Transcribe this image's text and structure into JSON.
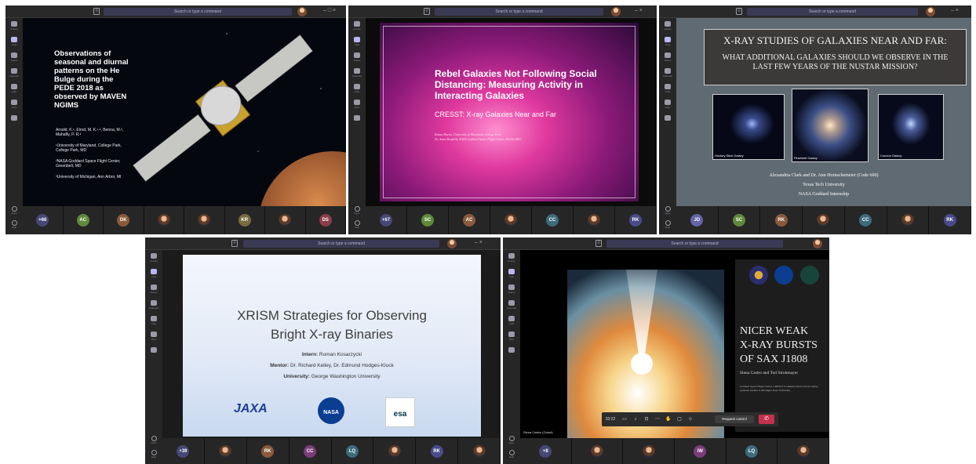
{
  "search": {
    "placeholder": "Search or type a command"
  },
  "rail_labels": [
    "Activity",
    "Chat",
    "Teams",
    "Calendar",
    "Calls",
    "Files",
    "..."
  ],
  "rail_bottom_labels": [
    "Apps",
    "Help"
  ],
  "window1": {
    "title_lines": [
      "Observations of",
      "seasonal and diurnal",
      "patterns on the He",
      "Bulge during the",
      "PEDE 2018 as",
      "observed by MAVEN",
      "NGIMS"
    ],
    "bullets": [
      "Arnold, K.¹, Elrod, M. K.¹·², Benna, M.², Mahaffy, P. R.²",
      "¹University of Maryland, College Park, College Park, MD",
      "²NASA Goddard Space Flight Center, Greenbelt, MD",
      "³University of Michigan, Ann Arbor, MI"
    ],
    "participants": [
      "+66",
      "AC",
      "DK",
      "",
      "",
      "KR",
      "",
      "DS"
    ],
    "colors": {
      "bg": "#0b0d18",
      "accent": "#5b5fc7"
    }
  },
  "window2": {
    "title": "Rebel Galaxies Not Following Social Distancing: Measuring Activity in Interacting Galaxies",
    "subtitle": "CRESST: X-ray Galaxies Near and Far",
    "authors": "Emma Harris, University of Maryland, College Park",
    "mentor": "Dr. Anna Bonfield, NASA Goddard Space Flight Center, NASA GSFC",
    "participants": [
      "+67",
      "SC",
      "AC",
      "",
      "CC",
      "",
      "RK"
    ],
    "colors": {
      "slide": "#c8338f"
    }
  },
  "window3": {
    "title": "X-RAY STUDIES OF GALAXIES NEAR AND FAR:",
    "subtitle": "WHAT ADDITIONAL GALAXIES SHOULD WE OBSERVE IN THE LAST FEW YEARS OF THE NUSTAR MISSION?",
    "images": [
      "Hockey Stick Galaxy",
      "Pinwheel Galaxy",
      "Cocoon Galaxy"
    ],
    "credits": [
      "Alexandria Clark and Dr. Ann Hornschemeier (Code 660)",
      "Texas Tech University",
      "NASA Goddard Internship"
    ],
    "participants": [
      "JD",
      "SC",
      "RK",
      "",
      "CC",
      "",
      "RK"
    ],
    "colors": {
      "slide": "#5f6a72"
    }
  },
  "window4": {
    "title_line1": "XRISM Strategies for Observing",
    "title_line2": "Bright X-ray Binaries",
    "intern_label": "Intern:",
    "intern": "Roman Kosarzycki",
    "mentor_label": "Mentor:",
    "mentor": "Dr. Richard Kelley, Dr. Edmund Hodges-Kluck",
    "university_label": "University:",
    "university": "George Washington University",
    "logos": [
      "JAXA",
      "NASA",
      "esa"
    ],
    "participants": [
      "+39",
      "",
      "RK",
      "CC",
      "LQ",
      "",
      "RK",
      ""
    ],
    "colors": {
      "slide": "#dce6f4"
    }
  },
  "window5": {
    "title_lines": [
      "NICER WEAK",
      "X-RAY BURSTS",
      "OF SAX J1808"
    ],
    "authors": "Siena Castro and Tod Strohmayer",
    "affiliation": "Goddard Space Flight Center, CRESST II summer intern and incoming graduate student at Michigan State University",
    "presenter": "Siena Castro (Guest)",
    "call_time": "33:22",
    "request_control": "Request control",
    "participants": [
      "+8",
      "",
      "",
      "IW",
      "LQ",
      ""
    ],
    "colors": {
      "leave": "#c4314b"
    }
  }
}
